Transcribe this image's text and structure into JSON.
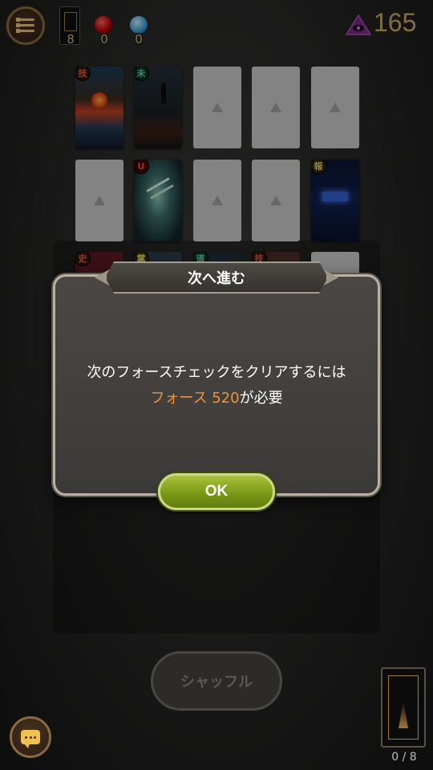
{
  "hud": {
    "deck_count": "8",
    "red_orb_count": "0",
    "blue_orb_count": "0",
    "points": "165"
  },
  "cards": {
    "row1": [
      {
        "type": "art",
        "badge": "技",
        "badge_color": "#e05a3a"
      },
      {
        "type": "art",
        "badge": "未",
        "badge_color": "#5ad0a0"
      },
      {
        "type": "placeholder"
      },
      {
        "type": "placeholder"
      },
      {
        "type": "placeholder"
      }
    ],
    "row2": [
      {
        "type": "placeholder"
      },
      {
        "type": "art",
        "badge": "U",
        "badge_color": "#ff4040"
      },
      {
        "type": "placeholder"
      },
      {
        "type": "placeholder"
      },
      {
        "type": "art",
        "badge": "報",
        "badge_color": "#e0d050"
      }
    ],
    "row3_badges": [
      "史",
      "掌",
      "道",
      "技"
    ]
  },
  "dialog": {
    "title": "次へ進む",
    "line1": "次のフォースチェックをクリアするには",
    "line2_highlight": "フォース 520",
    "line2_rest": "が必要",
    "ok_label": "OK",
    "highlight_color": "#f0913e"
  },
  "bottom": {
    "shuffle_label": "シャッフル",
    "deck_progress": "0 / 8"
  }
}
